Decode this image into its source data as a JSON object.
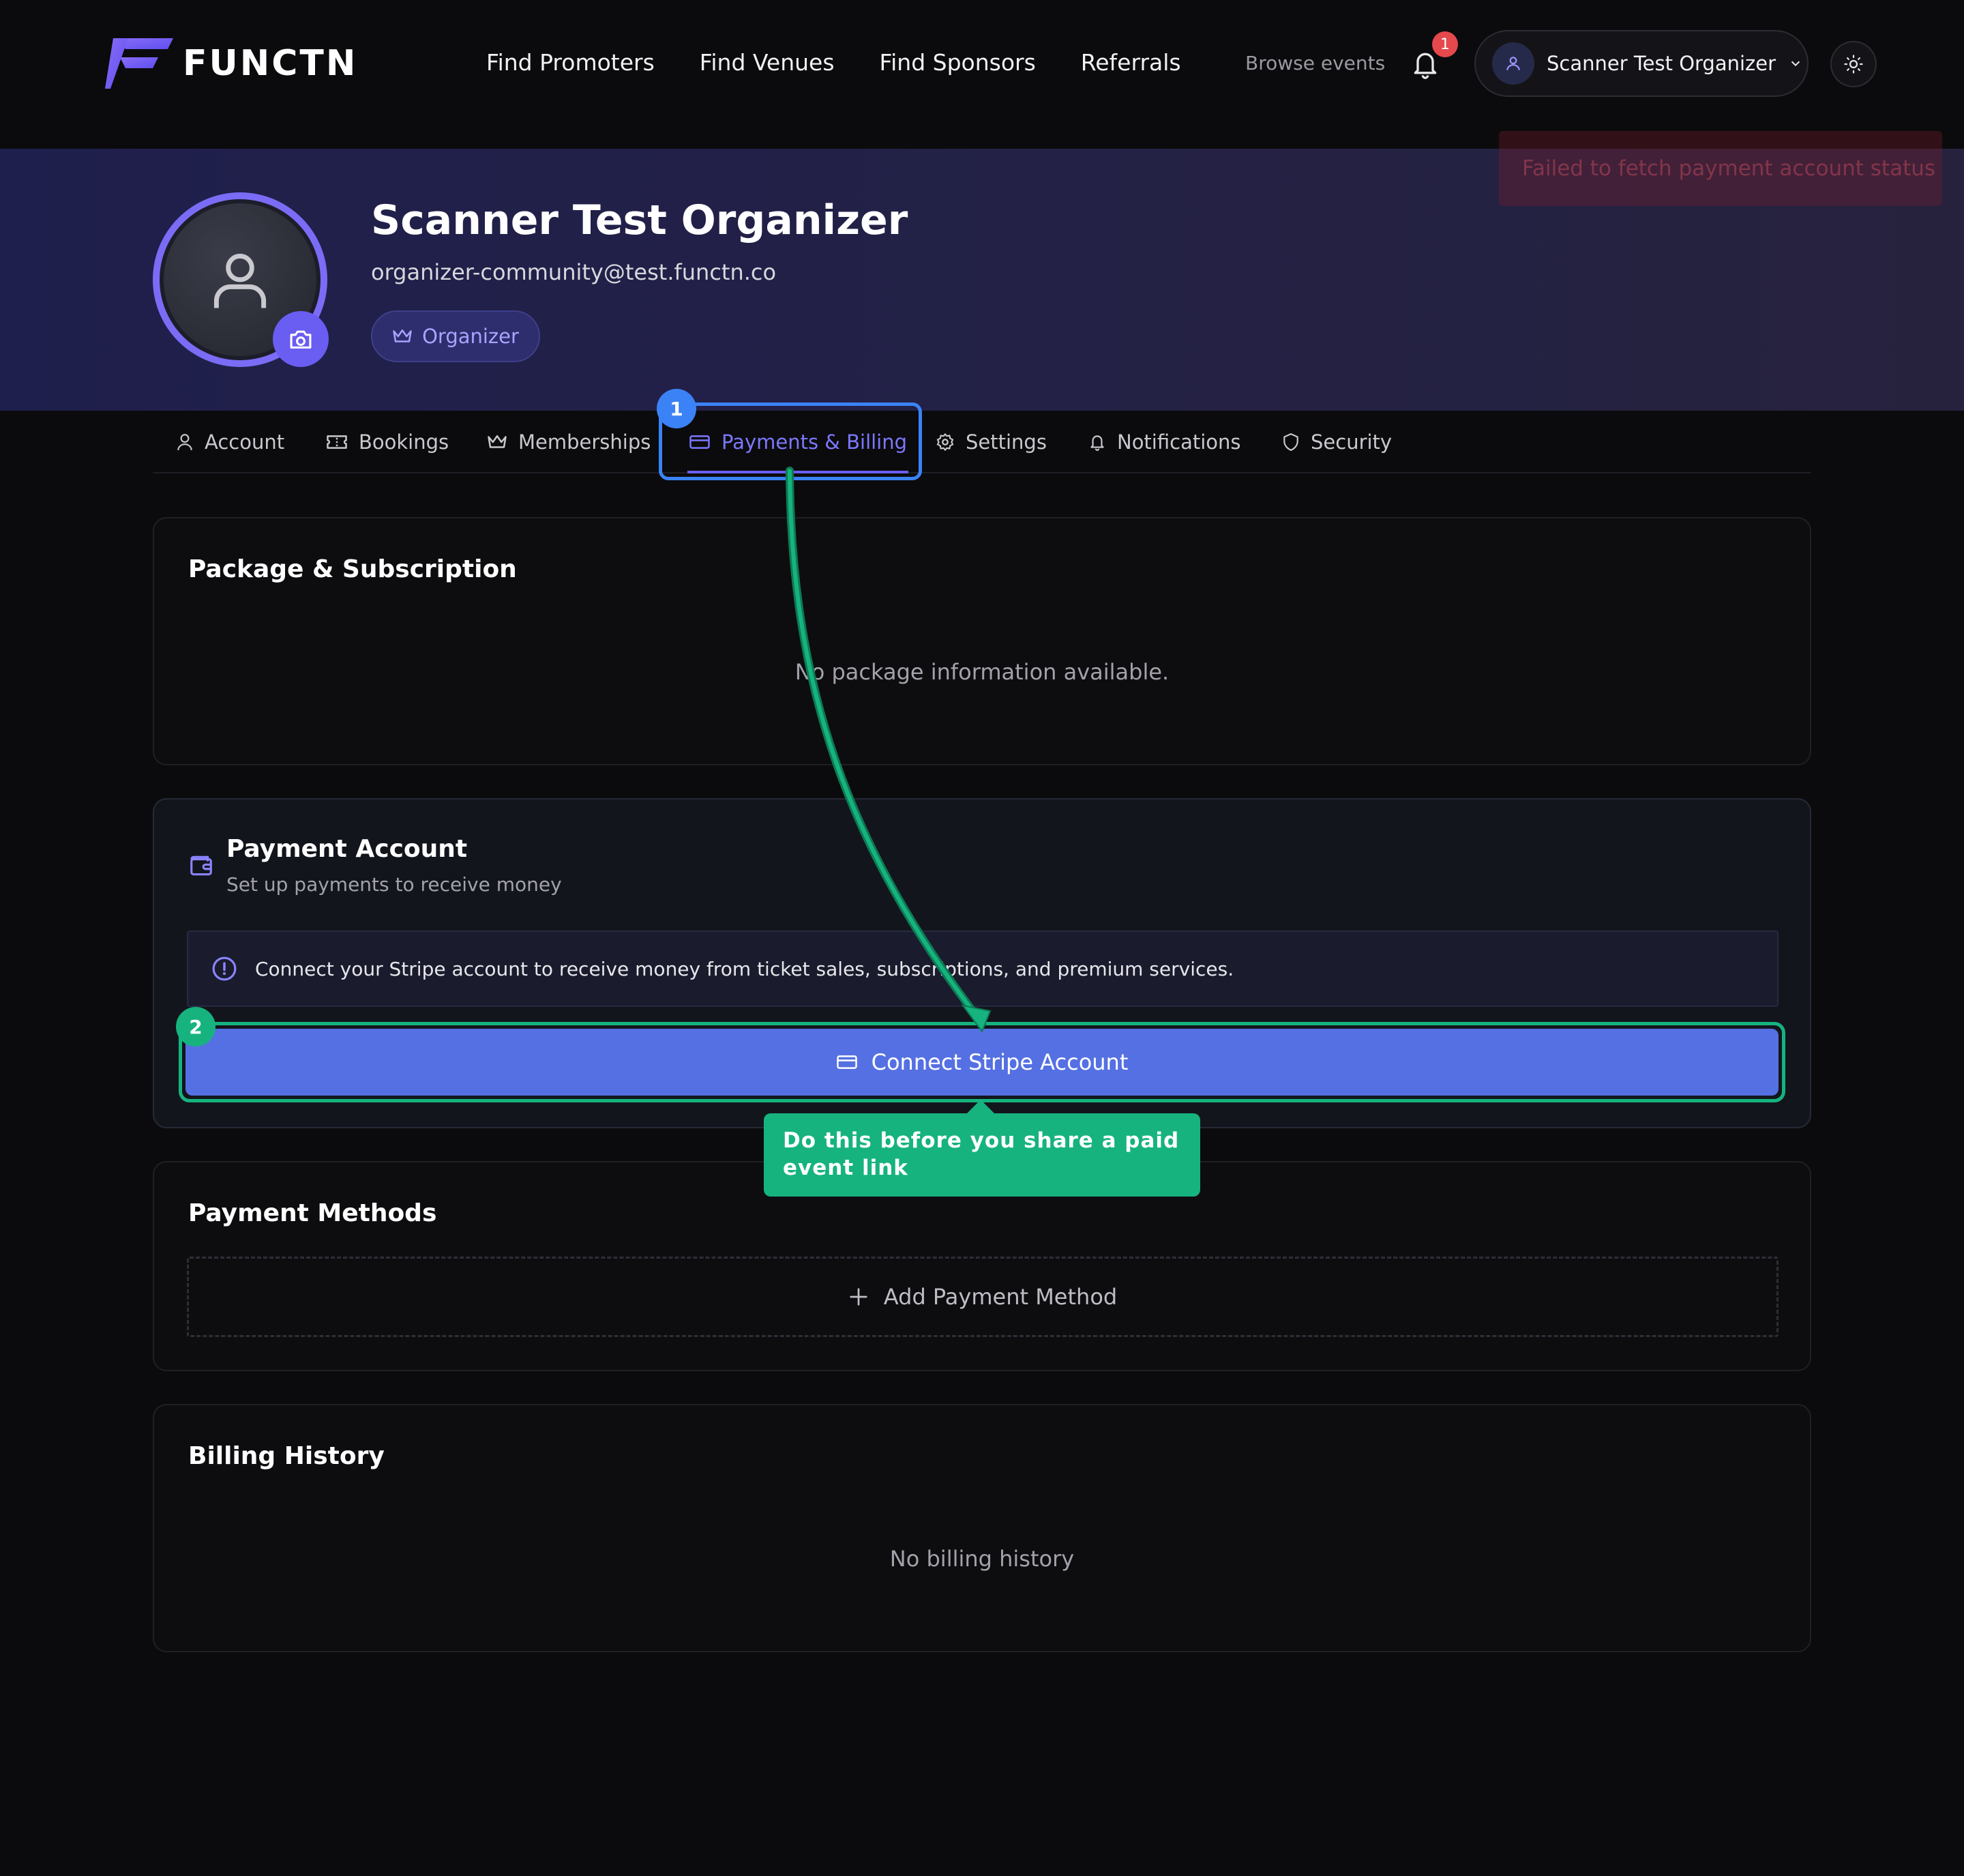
{
  "brand": {
    "name": "FUNCTN",
    "accent": "#6a5df2"
  },
  "nav": {
    "links": [
      "Find Promoters",
      "Find Venues",
      "Find Sponsors",
      "Referrals"
    ],
    "browse": "Browse events",
    "notification_count": "1",
    "user_name": "Scanner Test Organizer"
  },
  "toast": {
    "message": "Failed to fetch payment account status"
  },
  "profile": {
    "name": "Scanner Test Organizer",
    "email": "organizer-community@test.functn.co",
    "role": "Organizer"
  },
  "tabs": [
    {
      "label": "Account",
      "icon": "user-icon"
    },
    {
      "label": "Bookings",
      "icon": "ticket-icon"
    },
    {
      "label": "Memberships",
      "icon": "crown-icon"
    },
    {
      "label": "Payments & Billing",
      "icon": "credit-card-icon",
      "active": true
    },
    {
      "label": "Settings",
      "icon": "gear-icon"
    },
    {
      "label": "Notifications",
      "icon": "bell-icon"
    },
    {
      "label": "Security",
      "icon": "shield-icon"
    }
  ],
  "steps": {
    "one": "1",
    "two": "2"
  },
  "package": {
    "title": "Package & Subscription",
    "empty": "No package information available."
  },
  "payment_account": {
    "title": "Payment Account",
    "subtitle": "Set up payments to receive money",
    "info": "Connect your Stripe account to receive money from ticket sales, subscriptions, and premium services.",
    "button": "Connect Stripe Account",
    "tooltip": "Do this before you share a paid event link"
  },
  "payment_methods": {
    "title": "Payment Methods",
    "add": "Add Payment Method"
  },
  "billing_history": {
    "title": "Billing History",
    "empty": "No billing history"
  },
  "colors": {
    "highlight_blue": "#3b82f6",
    "highlight_green": "#16b37e",
    "button": "#5570e2"
  }
}
